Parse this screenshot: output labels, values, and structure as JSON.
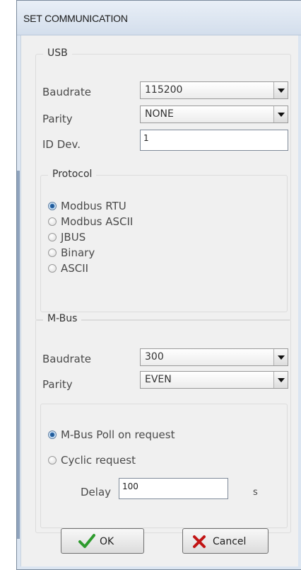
{
  "window": {
    "title": "SET COMMUNICATION"
  },
  "usb": {
    "legend": "USB",
    "baudrate_label": "Baudrate",
    "baudrate_value": "115200",
    "parity_label": "Parity",
    "parity_value": "NONE",
    "id_label": "ID Dev.",
    "id_value": "1"
  },
  "protocol": {
    "legend": "Protocol",
    "options": [
      "Modbus RTU",
      "Modbus ASCII",
      "JBUS",
      "Binary",
      "ASCII"
    ],
    "selected": "Modbus RTU"
  },
  "mbus": {
    "legend": "M-Bus",
    "baudrate_label": "Baudrate",
    "baudrate_value": "300",
    "parity_label": "Parity",
    "parity_value": "EVEN",
    "poll_on_request_label": "M-Bus Poll on request",
    "cyclic_label": "Cyclic request",
    "selected_mode": "M-Bus Poll on request",
    "delay_label": "Delay",
    "delay_value": "100",
    "delay_unit": "s"
  },
  "buttons": {
    "ok_label": "OK",
    "cancel_label": "Cancel"
  },
  "colors": {
    "ok_check": "#2e9b2e",
    "cancel_x": "#c21414",
    "radio_selected": "#2f6fb3"
  },
  "icons": {
    "ok": "check-icon",
    "cancel": "x-icon"
  }
}
